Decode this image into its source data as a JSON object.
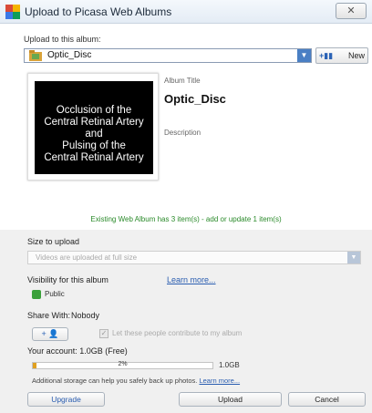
{
  "window": {
    "title": "Upload to Picasa Web Albums",
    "close_glyph": "✕"
  },
  "album_section": {
    "upload_label": "Upload to this album:",
    "selected_album": "Optic_Disc",
    "new_button_label": "New"
  },
  "thumbnail": {
    "lines": [
      "Occlusion of the",
      "Central Retinal Artery",
      "and",
      "Pulsing of the",
      "Central Retinal Artery"
    ]
  },
  "album_details": {
    "title_label": "Album Title",
    "title_value": "Optic_Disc",
    "description_label": "Description"
  },
  "existing_note": "Existing Web Album has 3 item(s) - add or update 1 item(s)",
  "size_section": {
    "heading": "Size to upload",
    "value": "Videos are uploaded at full size"
  },
  "visibility_section": {
    "heading": "Visibility for this album",
    "learn_more": "Learn more...",
    "value": "Public"
  },
  "share_section": {
    "heading": "Share With:",
    "value": "Nobody",
    "add_button": "+ 👤",
    "contribute_label": "Let these people contribute to my album"
  },
  "account_section": {
    "label": "Your account: 1.0GB (Free)",
    "usage_fraction": 0.02,
    "usage_percent_label": "2%",
    "capacity_label": "1.0GB",
    "storage_text": "Additional storage can help you safely back up photos.",
    "storage_link": "Learn more..."
  },
  "buttons": {
    "upgrade": "Upgrade",
    "upload": "Upload",
    "cancel": "Cancel"
  },
  "colors": {
    "accent_blue": "#2a5db0",
    "existing_green": "#2a8a2a",
    "usage_fill": "#e0a020"
  }
}
